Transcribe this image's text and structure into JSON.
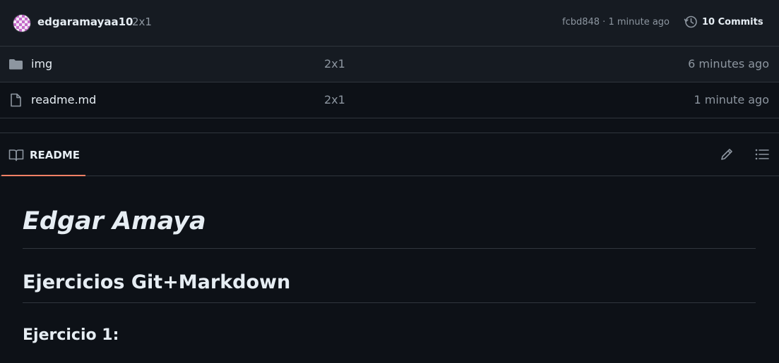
{
  "latest_commit": {
    "author": "edgaramayaa10",
    "message": "2x1",
    "meta": "fcbd848 · 1 minute ago",
    "commits_label": "10 Commits"
  },
  "files": [
    {
      "icon": "folder-icon",
      "name": "img",
      "commit": "2x1",
      "time": "6 minutes ago"
    },
    {
      "icon": "file-icon",
      "name": "readme.md",
      "commit": "2x1",
      "time": "1 minute ago"
    }
  ],
  "readme": {
    "tab_label": "README",
    "h1": "Edgar Amaya",
    "h2": "Ejercicios Git+Markdown",
    "h3": "Ejercicio 1:"
  },
  "colors": {
    "background": "#0d1117",
    "header_bg": "#161b22",
    "border": "#30363d",
    "muted_text": "#8d96a0",
    "accent_underline": "#f78166"
  }
}
